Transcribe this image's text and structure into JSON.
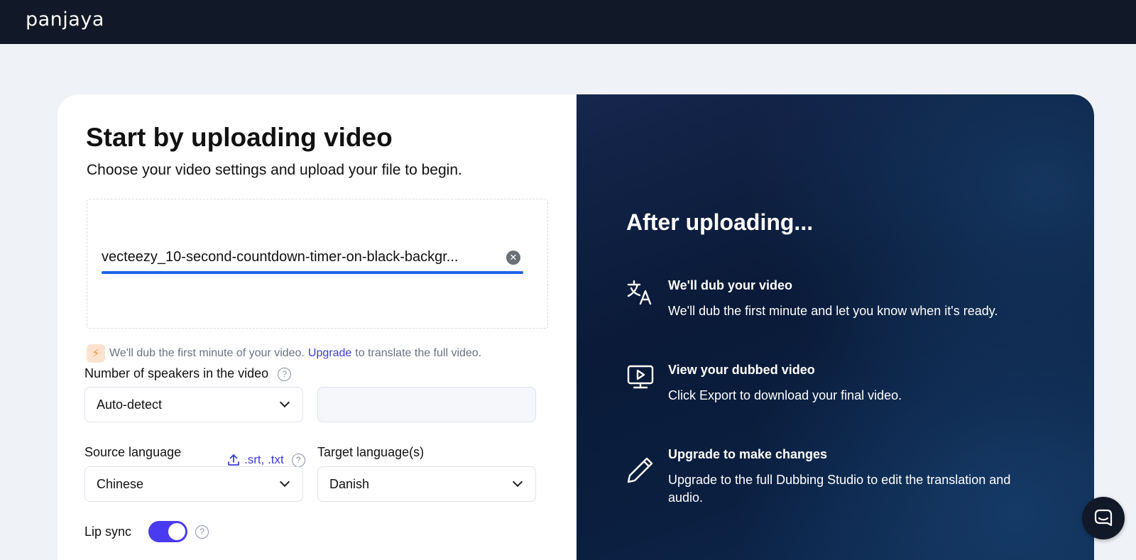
{
  "brand": {
    "logo": "panjaya"
  },
  "upload": {
    "title": "Start by uploading video",
    "subtitle": "Choose your video settings and upload your file to begin.",
    "file_name": "vecteezy_10-second-countdown-timer-on-black-backgr...",
    "clear_icon": "close-circle-icon"
  },
  "notice": {
    "icon": "lightning-icon",
    "text_before": "We'll dub the first minute of your video.",
    "link": "Upgrade",
    "text_after": "to translate the full video."
  },
  "speakers": {
    "label": "Number of speakers in the video",
    "value": "Auto-detect",
    "secondary_value": ""
  },
  "source_language": {
    "label": "Source language",
    "upload_link": ".srt, .txt",
    "value": "Chinese"
  },
  "target_language": {
    "label": "Target language(s)",
    "value": "Danish"
  },
  "lip_sync": {
    "label": "Lip sync",
    "enabled": true
  },
  "after": {
    "title": "After uploading...",
    "steps": [
      {
        "icon": "translate-icon",
        "title": "We'll dub your video",
        "desc": "We'll dub the first minute and let you know when it's ready."
      },
      {
        "icon": "video-play-icon",
        "title": "View your dubbed video",
        "desc": "Click Export to download your final video."
      },
      {
        "icon": "pencil-icon",
        "title": "Upgrade to make changes",
        "desc": "Upgrade to the full Dubbing Studio to edit the translation and audio."
      }
    ]
  },
  "colors": {
    "accent": "#4b3bf0",
    "link": "#3d3ddb",
    "topbar": "#111827",
    "underline": "#1d63e7"
  }
}
